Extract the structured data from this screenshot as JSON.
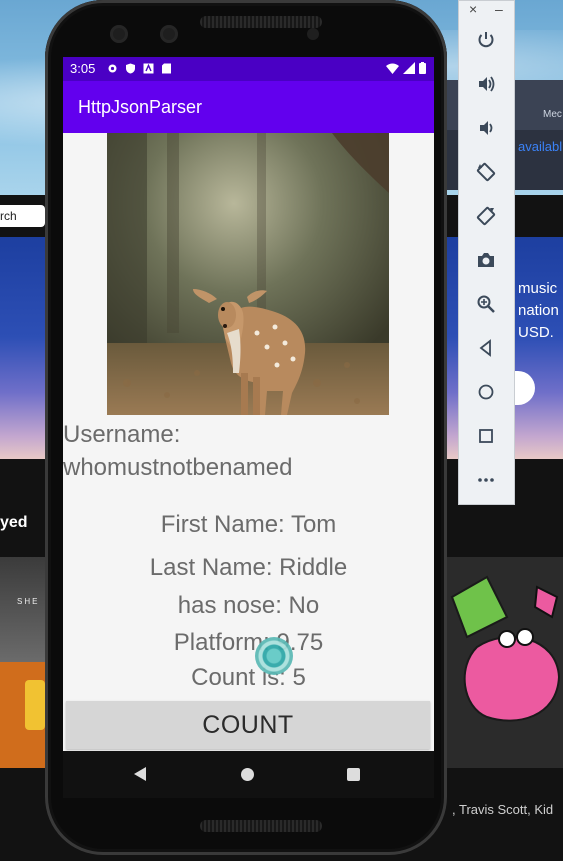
{
  "background": {
    "window_label_partial": "Mec",
    "link_partial": "availabl",
    "search_partial": "rch",
    "promo_lines": [
      "music",
      "nation",
      "USD."
    ],
    "recently_played_partial": "yed",
    "tile_label": "SHE",
    "artists_partial": ", Travis Scott, Kid"
  },
  "toolbar": {
    "close_label": "×",
    "minimize_label": "–",
    "buttons": [
      "power-icon",
      "volume-up-icon",
      "volume-down-icon",
      "rotate-left-icon",
      "rotate-right-icon",
      "camera-icon",
      "zoom-icon",
      "back-icon",
      "home-icon",
      "overview-icon",
      "more-icon"
    ]
  },
  "status_bar": {
    "time": "3:05"
  },
  "app": {
    "title": "HttpJsonParser",
    "username_line1": "Username:",
    "username_line2": "whomustnotbenamed",
    "first_name": "First Name: Tom",
    "last_name": "Last Name: Riddle",
    "has_nose": "has nose: No",
    "platform": "Platform: 9.75",
    "count": "Count is: 5",
    "count_button": "COUNT"
  },
  "colors": {
    "status_bar": "#4a00c4",
    "app_bar": "#6200ee",
    "text": "#6b6b6b",
    "button": "#d6d6d6"
  }
}
